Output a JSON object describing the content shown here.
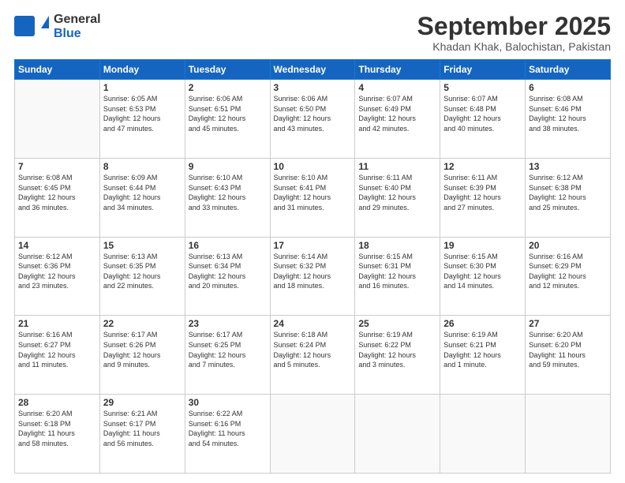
{
  "header": {
    "logo_general": "General",
    "logo_blue": "Blue",
    "month_title": "September 2025",
    "subtitle": "Khadan Khak, Balochistan, Pakistan"
  },
  "days_header": [
    "Sunday",
    "Monday",
    "Tuesday",
    "Wednesday",
    "Thursday",
    "Friday",
    "Saturday"
  ],
  "weeks": [
    [
      {
        "day": "",
        "info": ""
      },
      {
        "day": "1",
        "info": "Sunrise: 6:05 AM\nSunset: 6:53 PM\nDaylight: 12 hours\nand 47 minutes."
      },
      {
        "day": "2",
        "info": "Sunrise: 6:06 AM\nSunset: 6:51 PM\nDaylight: 12 hours\nand 45 minutes."
      },
      {
        "day": "3",
        "info": "Sunrise: 6:06 AM\nSunset: 6:50 PM\nDaylight: 12 hours\nand 43 minutes."
      },
      {
        "day": "4",
        "info": "Sunrise: 6:07 AM\nSunset: 6:49 PM\nDaylight: 12 hours\nand 42 minutes."
      },
      {
        "day": "5",
        "info": "Sunrise: 6:07 AM\nSunset: 6:48 PM\nDaylight: 12 hours\nand 40 minutes."
      },
      {
        "day": "6",
        "info": "Sunrise: 6:08 AM\nSunset: 6:46 PM\nDaylight: 12 hours\nand 38 minutes."
      }
    ],
    [
      {
        "day": "7",
        "info": "Sunrise: 6:08 AM\nSunset: 6:45 PM\nDaylight: 12 hours\nand 36 minutes."
      },
      {
        "day": "8",
        "info": "Sunrise: 6:09 AM\nSunset: 6:44 PM\nDaylight: 12 hours\nand 34 minutes."
      },
      {
        "day": "9",
        "info": "Sunrise: 6:10 AM\nSunset: 6:43 PM\nDaylight: 12 hours\nand 33 minutes."
      },
      {
        "day": "10",
        "info": "Sunrise: 6:10 AM\nSunset: 6:41 PM\nDaylight: 12 hours\nand 31 minutes."
      },
      {
        "day": "11",
        "info": "Sunrise: 6:11 AM\nSunset: 6:40 PM\nDaylight: 12 hours\nand 29 minutes."
      },
      {
        "day": "12",
        "info": "Sunrise: 6:11 AM\nSunset: 6:39 PM\nDaylight: 12 hours\nand 27 minutes."
      },
      {
        "day": "13",
        "info": "Sunrise: 6:12 AM\nSunset: 6:38 PM\nDaylight: 12 hours\nand 25 minutes."
      }
    ],
    [
      {
        "day": "14",
        "info": "Sunrise: 6:12 AM\nSunset: 6:36 PM\nDaylight: 12 hours\nand 23 minutes."
      },
      {
        "day": "15",
        "info": "Sunrise: 6:13 AM\nSunset: 6:35 PM\nDaylight: 12 hours\nand 22 minutes."
      },
      {
        "day": "16",
        "info": "Sunrise: 6:13 AM\nSunset: 6:34 PM\nDaylight: 12 hours\nand 20 minutes."
      },
      {
        "day": "17",
        "info": "Sunrise: 6:14 AM\nSunset: 6:32 PM\nDaylight: 12 hours\nand 18 minutes."
      },
      {
        "day": "18",
        "info": "Sunrise: 6:15 AM\nSunset: 6:31 PM\nDaylight: 12 hours\nand 16 minutes."
      },
      {
        "day": "19",
        "info": "Sunrise: 6:15 AM\nSunset: 6:30 PM\nDaylight: 12 hours\nand 14 minutes."
      },
      {
        "day": "20",
        "info": "Sunrise: 6:16 AM\nSunset: 6:29 PM\nDaylight: 12 hours\nand 12 minutes."
      }
    ],
    [
      {
        "day": "21",
        "info": "Sunrise: 6:16 AM\nSunset: 6:27 PM\nDaylight: 12 hours\nand 11 minutes."
      },
      {
        "day": "22",
        "info": "Sunrise: 6:17 AM\nSunset: 6:26 PM\nDaylight: 12 hours\nand 9 minutes."
      },
      {
        "day": "23",
        "info": "Sunrise: 6:17 AM\nSunset: 6:25 PM\nDaylight: 12 hours\nand 7 minutes."
      },
      {
        "day": "24",
        "info": "Sunrise: 6:18 AM\nSunset: 6:24 PM\nDaylight: 12 hours\nand 5 minutes."
      },
      {
        "day": "25",
        "info": "Sunrise: 6:19 AM\nSunset: 6:22 PM\nDaylight: 12 hours\nand 3 minutes."
      },
      {
        "day": "26",
        "info": "Sunrise: 6:19 AM\nSunset: 6:21 PM\nDaylight: 12 hours\nand 1 minute."
      },
      {
        "day": "27",
        "info": "Sunrise: 6:20 AM\nSunset: 6:20 PM\nDaylight: 11 hours\nand 59 minutes."
      }
    ],
    [
      {
        "day": "28",
        "info": "Sunrise: 6:20 AM\nSunset: 6:18 PM\nDaylight: 11 hours\nand 58 minutes."
      },
      {
        "day": "29",
        "info": "Sunrise: 6:21 AM\nSunset: 6:17 PM\nDaylight: 11 hours\nand 56 minutes."
      },
      {
        "day": "30",
        "info": "Sunrise: 6:22 AM\nSunset: 6:16 PM\nDaylight: 11 hours\nand 54 minutes."
      },
      {
        "day": "",
        "info": ""
      },
      {
        "day": "",
        "info": ""
      },
      {
        "day": "",
        "info": ""
      },
      {
        "day": "",
        "info": ""
      }
    ]
  ]
}
